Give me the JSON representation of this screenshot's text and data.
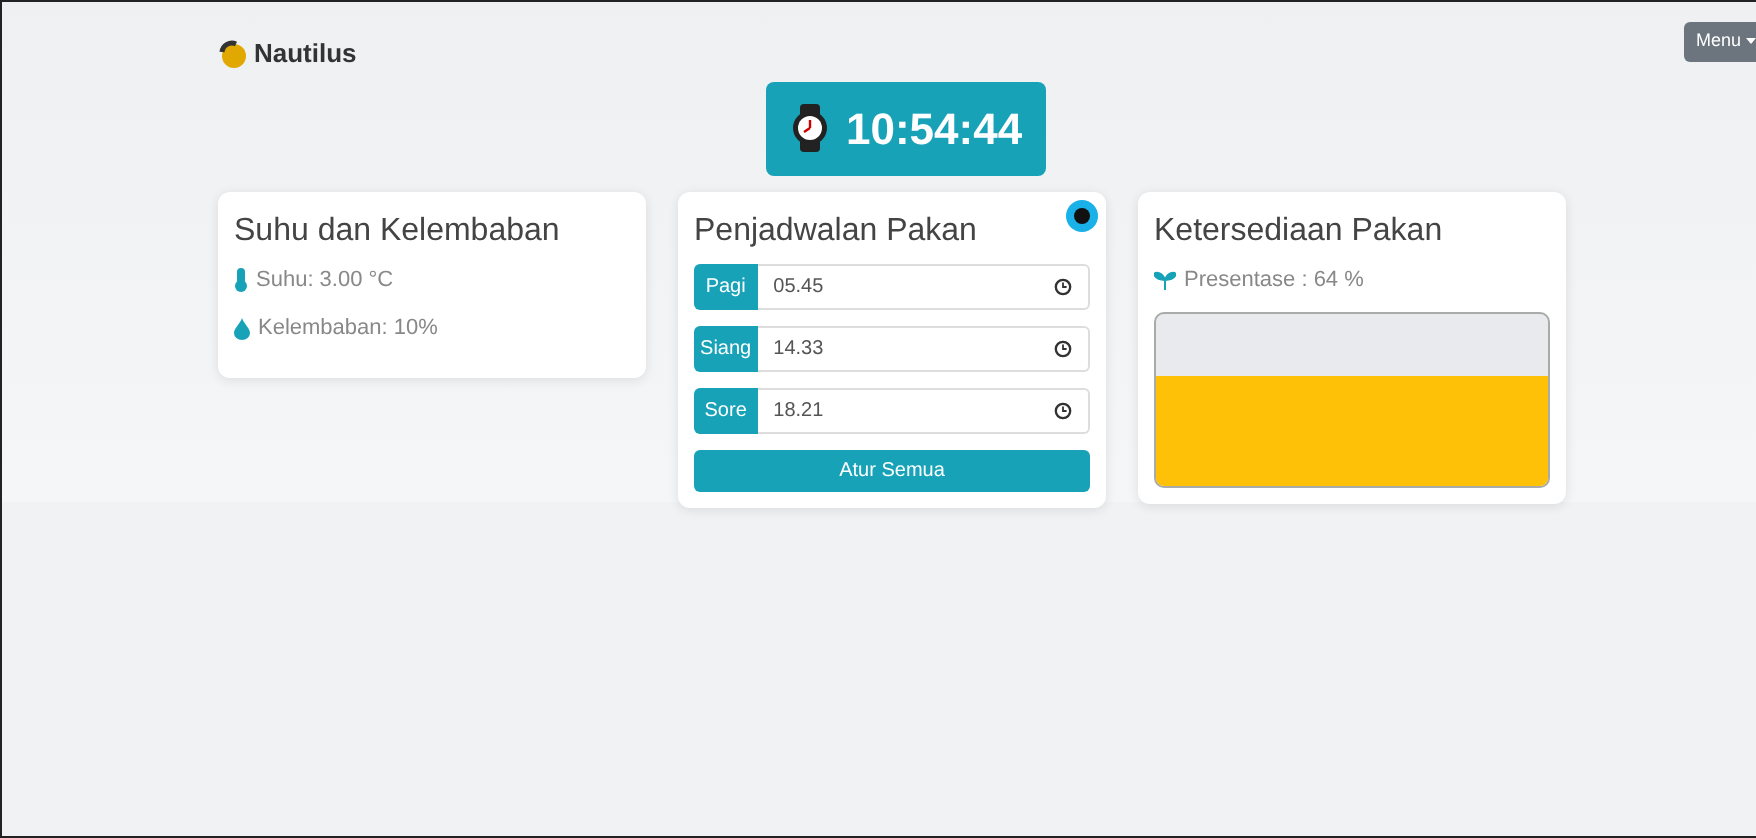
{
  "brand": {
    "name": "Nautilus"
  },
  "menu_button": {
    "label": "Menu"
  },
  "clock": {
    "time": "10:54:44"
  },
  "climate_card": {
    "title": "Suhu dan Kelembaban",
    "readings": [
      {
        "kind": "temperature",
        "text": "Suhu: 3.00 °C"
      },
      {
        "kind": "humidity",
        "text": "Kelembaban: 10%"
      }
    ]
  },
  "schedule_card": {
    "title": "Penjadwalan Pakan",
    "slots": [
      {
        "label": "Pagi",
        "value": "05.45"
      },
      {
        "label": "Siang",
        "value": "14.33"
      },
      {
        "label": "Sore",
        "value": "18.21"
      }
    ],
    "button": "Atur Semua"
  },
  "stock_card": {
    "title": "Ketersediaan Pakan",
    "reading": "Presentase : 64 %"
  }
}
